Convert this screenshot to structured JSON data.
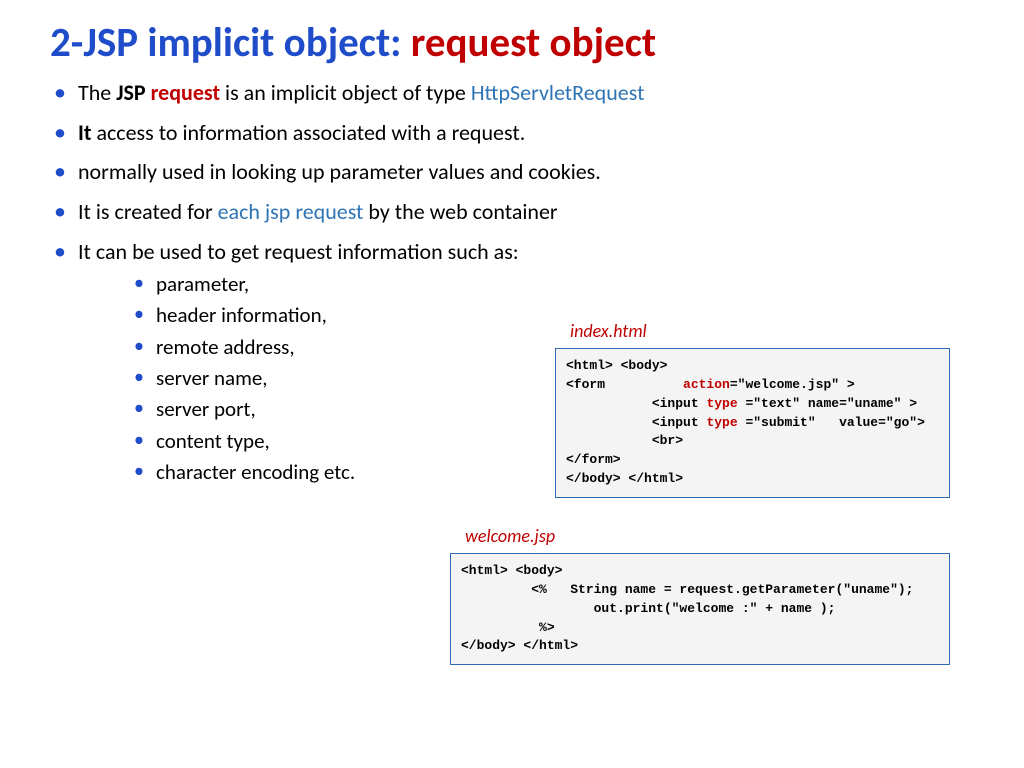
{
  "title": {
    "blue": "2-JSP implicit object: ",
    "red": "request object"
  },
  "bullets": {
    "b1a": "The ",
    "b1b": "JSP ",
    "b1c": "request ",
    "b1d": "is an implicit object of type ",
    "b1e": "HttpServletRequest",
    "b2a": "It ",
    "b2b": "access to information associated with a request.",
    "b3": "normally used in looking up parameter values and cookies.",
    "b4a": "It is created for ",
    "b4b": "each jsp request ",
    "b4c": "by the web container",
    "b5": "It can be used to get request information such as:"
  },
  "sub": {
    "s1": "parameter,",
    "s2": "header information,",
    "s3": "remote address,",
    "s4": "server name,",
    "s5": "server port,",
    "s6": "content type,",
    "s7": "character encoding etc."
  },
  "labels": {
    "index": "index.html",
    "welcome": "welcome.jsp"
  },
  "code1": {
    "l1": "<html> <body>",
    "l2a": "<form          ",
    "l2b": "action",
    "l2c": "=\"welcome.jsp\" >",
    "l3a": "           <input ",
    "l3b": "type ",
    "l3c": "=\"text\" name=\"uname\" >",
    "l4a": "           <input ",
    "l4b": "type ",
    "l4c": "=\"submit\"   value=\"go\">",
    "l5": "           <br>",
    "l6": "</form>",
    "l7": "</body> </html>"
  },
  "code2": {
    "l1": "<html> <body>",
    "l2": "         <%   String name = request.getParameter(\"uname\");",
    "l3": "                 out.print(\"welcome :\" + name );",
    "l4": "          %>",
    "l5": "</body> </html>"
  }
}
